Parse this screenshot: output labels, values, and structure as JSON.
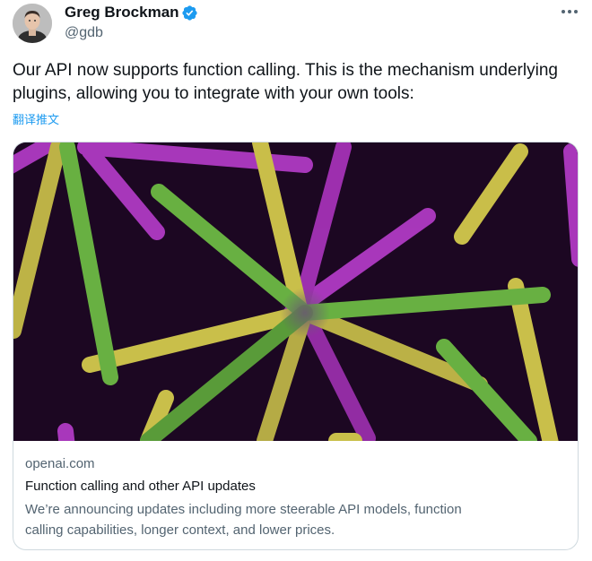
{
  "author": {
    "name": "Greg Brockman",
    "handle": "@gdb"
  },
  "icons": {
    "verified": "verified-badge-icon",
    "more": "more-horizontal-icon",
    "avatar": "user-avatar-photo"
  },
  "tweet": {
    "text": "Our API now supports function calling. This is the mechanism underlying\nplugins, allowing you to integrate with your own tools:",
    "translate_label": "翻译推文"
  },
  "link_card": {
    "domain": "openai.com",
    "title": "Function calling and other API updates",
    "description": "We’re announcing updates including more steerable API models, function\ncalling capabilities, longer context, and lower prices."
  },
  "colors": {
    "accent": "#1d9bf0",
    "image_background": "#1c0722",
    "ray_magenta": "#b43cc8",
    "ray_yellow": "#d8cf4e",
    "ray_green": "#6fbf45"
  }
}
